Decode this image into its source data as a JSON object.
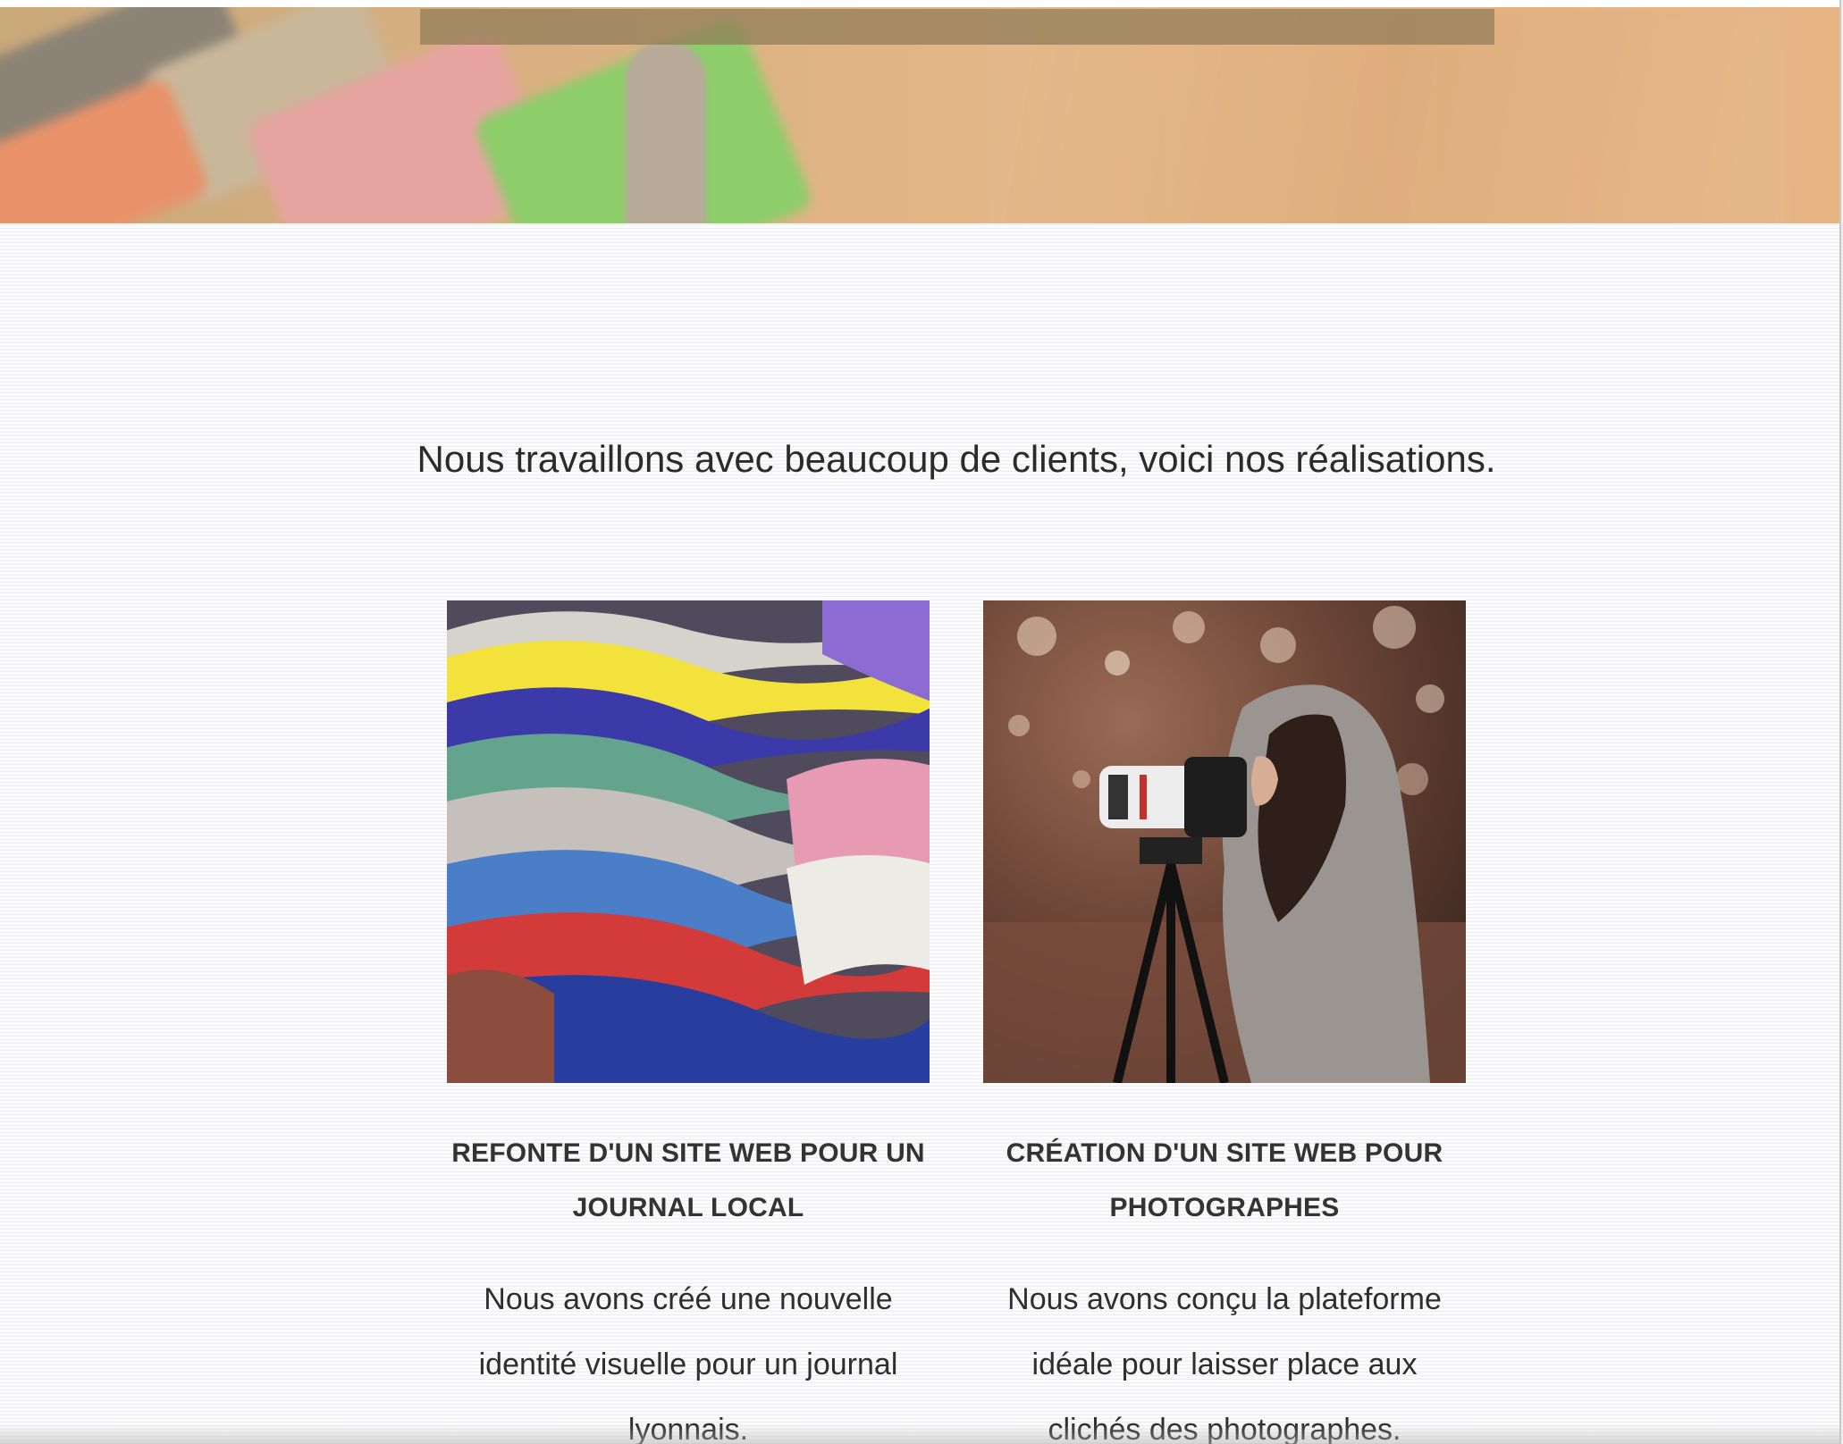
{
  "intro": {
    "text": "Nous travaillons avec beaucoup de clients, voici nos réalisations."
  },
  "projects": [
    {
      "title": "REFONTE D'UN SITE WEB POUR UN JOURNAL LOCAL",
      "description": "Nous avons créé une nouvelle identité visuelle pour un journal lyonnais.",
      "image": "colorful-magazines-stack"
    },
    {
      "title": "CRÉATION D'UN SITE WEB POUR PHOTOGRAPHES",
      "description": "Nous avons conçu la plateforme idéale pour laisser place aux clichés des photographes.",
      "image": "photographer-with-tripod-camera"
    }
  ],
  "colors": {
    "text": "#2b2b2b",
    "heading": "#333333",
    "hero_overlay": "#917d5a"
  }
}
